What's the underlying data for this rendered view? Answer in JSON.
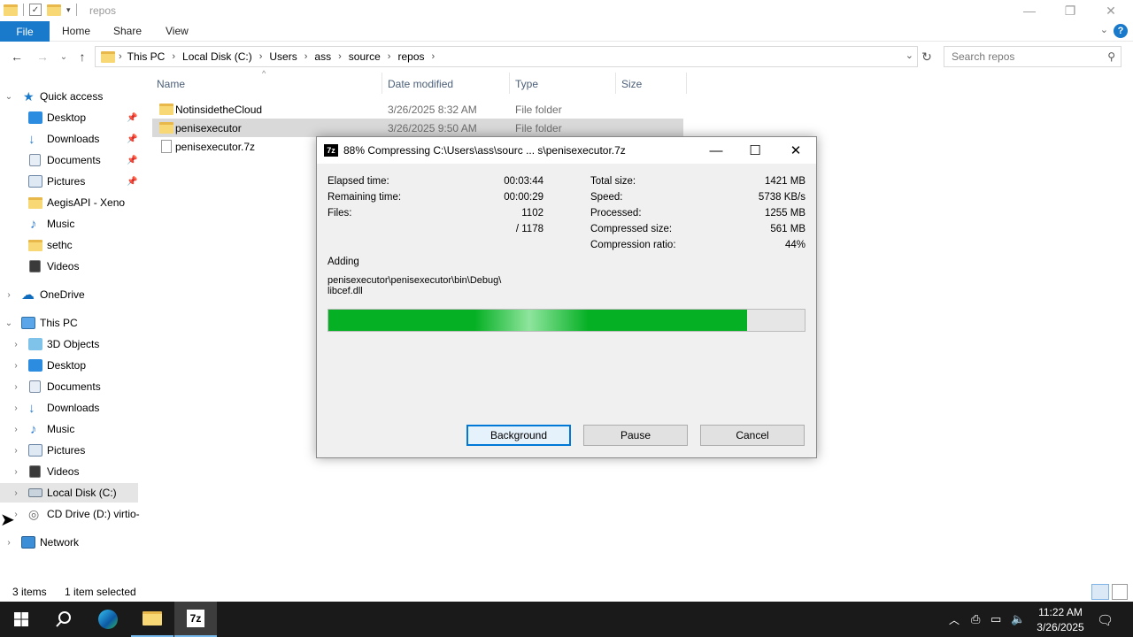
{
  "window": {
    "title": "repos"
  },
  "ribbon": {
    "file": "File",
    "home": "Home",
    "share": "Share",
    "view": "View"
  },
  "address": {
    "crumbs": [
      "This PC",
      "Local Disk (C:)",
      "Users",
      "ass",
      "source",
      "repos"
    ],
    "search_placeholder": "Search repos"
  },
  "sidebar": {
    "quick_access": "Quick access",
    "qa_items": [
      "Desktop",
      "Downloads",
      "Documents",
      "Pictures",
      "AegisAPI - Xeno",
      "Music",
      "sethc",
      "Videos"
    ],
    "onedrive": "OneDrive",
    "this_pc": "This PC",
    "pc_items": [
      "3D Objects",
      "Desktop",
      "Documents",
      "Downloads",
      "Music",
      "Pictures",
      "Videos",
      "Local Disk (C:)",
      "CD Drive (D:) virtio-"
    ],
    "network": "Network"
  },
  "columns": {
    "name": "Name",
    "date": "Date modified",
    "type": "Type",
    "size": "Size"
  },
  "files": [
    {
      "name": "NotinsidetheCloud",
      "date": "3/26/2025 8:32 AM",
      "type": "File folder"
    },
    {
      "name": "penisexecutor",
      "date": "3/26/2025 9:50 AM",
      "type": "File folder"
    },
    {
      "name": "penisexecutor.7z",
      "date": "",
      "type": ""
    }
  ],
  "status": {
    "items": "3 items",
    "selected": "1 item selected"
  },
  "dialog": {
    "icon_text": "7z",
    "title": "88% Compressing C:\\Users\\ass\\sourc ... s\\penisexecutor.7z",
    "elapsed_label": "Elapsed time:",
    "elapsed": "00:03:44",
    "remaining_label": "Remaining time:",
    "remaining": "00:00:29",
    "files_label": "Files:",
    "files": "1102",
    "files_total": "/ 1178",
    "total_size_label": "Total size:",
    "total_size": "1421 MB",
    "speed_label": "Speed:",
    "speed": "5738 KB/s",
    "processed_label": "Processed:",
    "processed": "1255 MB",
    "compressed_label": "Compressed size:",
    "compressed": "561 MB",
    "ratio_label": "Compression ratio:",
    "ratio": "44%",
    "adding_label": "Adding",
    "path_line1": "penisexecutor\\penisexecutor\\bin\\Debug\\",
    "path_line2": "libcef.dll",
    "progress": 0.88,
    "btn_background": "Background",
    "btn_pause": "Pause",
    "btn_cancel": "Cancel"
  },
  "taskbar": {
    "time": "11:22 AM",
    "date": "3/26/2025"
  }
}
